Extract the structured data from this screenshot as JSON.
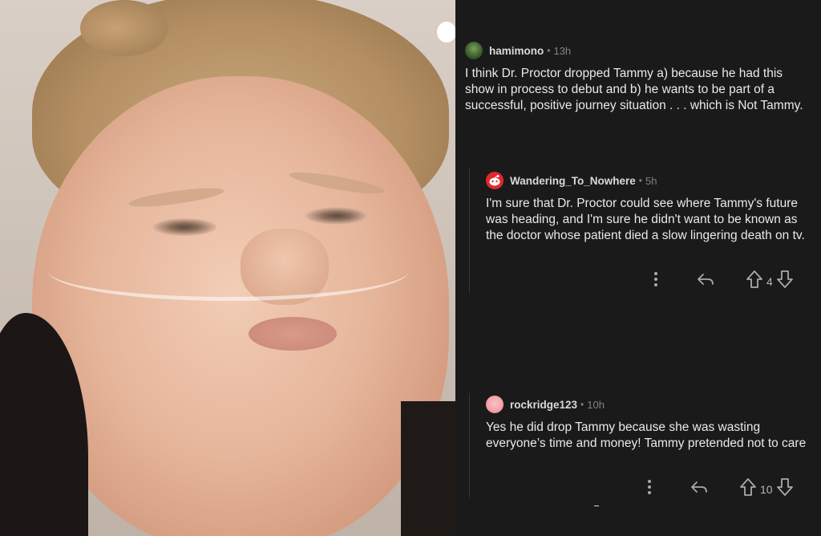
{
  "comments": [
    {
      "author": "hamimono",
      "separator": "•",
      "time": "13h",
      "text": "I think Dr. Proctor dropped Tammy a) because he had this show in process to debut and b) he wants to be part of a successful, positive journey situation . . . which is Not Tammy.",
      "avatar_color": "#3b5b2b"
    },
    {
      "author": "Wandering_To_Nowhere",
      "separator": "•",
      "time": "5h",
      "text": "I'm sure that Dr. Proctor could see where Tammy's future was heading, and I'm sure he didn't want to be known as the doctor whose patient died a slow lingering death on tv.",
      "avatar_color": "#e0282e",
      "votes": "4"
    },
    {
      "author": "rockridge123",
      "separator": "•",
      "time": "10h",
      "text": "Yes he did drop Tammy because she was wasting everyone’s time and money! Tammy pretended not to care",
      "avatar_color": "#f2a3a8",
      "votes": "10"
    }
  ],
  "colors": {
    "panel_bg": "#1a1a1b",
    "text": "#d7dadc",
    "muted": "#818384"
  },
  "icons": [
    "more-options-icon",
    "reply-icon",
    "upvote-icon",
    "downvote-icon"
  ]
}
